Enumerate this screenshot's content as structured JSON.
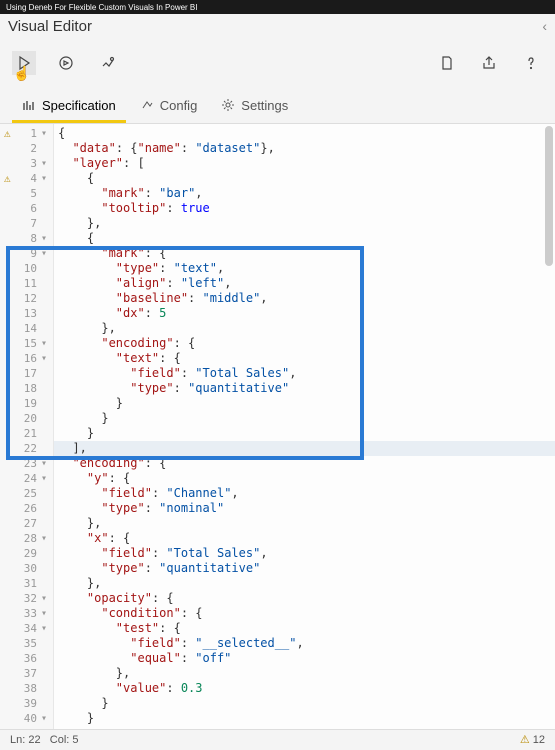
{
  "video_title": "Using Deneb For Flexible Custom Visuals In Power BI",
  "panel_title": "Visual Editor",
  "tabs": [
    {
      "label": "Specification",
      "active": true
    },
    {
      "label": "Config",
      "active": false
    },
    {
      "label": "Settings",
      "active": false
    }
  ],
  "status": {
    "ln": "Ln: 22",
    "col": "Col: 5",
    "warnings": "12"
  },
  "gutter": [
    {
      "n": "1",
      "warn": true,
      "fold": "▾"
    },
    {
      "n": "2"
    },
    {
      "n": "3",
      "fold": "▾"
    },
    {
      "n": "4",
      "warn": true,
      "fold": "▾"
    },
    {
      "n": "5"
    },
    {
      "n": "6"
    },
    {
      "n": "7"
    },
    {
      "n": "8",
      "fold": "▾"
    },
    {
      "n": "9",
      "fold": "▾"
    },
    {
      "n": "10"
    },
    {
      "n": "11"
    },
    {
      "n": "12"
    },
    {
      "n": "13"
    },
    {
      "n": "14"
    },
    {
      "n": "15",
      "fold": "▾"
    },
    {
      "n": "16",
      "fold": "▾"
    },
    {
      "n": "17"
    },
    {
      "n": "18"
    },
    {
      "n": "19"
    },
    {
      "n": "20"
    },
    {
      "n": "21"
    },
    {
      "n": "22"
    },
    {
      "n": "23",
      "fold": "▾"
    },
    {
      "n": "24",
      "fold": "▾"
    },
    {
      "n": "25"
    },
    {
      "n": "26"
    },
    {
      "n": "27"
    },
    {
      "n": "28",
      "fold": "▾"
    },
    {
      "n": "29"
    },
    {
      "n": "30"
    },
    {
      "n": "31"
    },
    {
      "n": "32",
      "fold": "▾"
    },
    {
      "n": "33",
      "fold": "▾"
    },
    {
      "n": "34",
      "fold": "▾"
    },
    {
      "n": "35"
    },
    {
      "n": "36"
    },
    {
      "n": "37"
    },
    {
      "n": "38"
    },
    {
      "n": "39"
    },
    {
      "n": "40",
      "fold": "▾"
    }
  ],
  "code": [
    [
      [
        "p",
        "{"
      ]
    ],
    [
      [
        "p",
        "  "
      ],
      [
        "k",
        "\"data\""
      ],
      [
        "p",
        ": {"
      ],
      [
        "k",
        "\"name\""
      ],
      [
        "p",
        ": "
      ],
      [
        "s",
        "\"dataset\""
      ],
      [
        "p",
        "},"
      ]
    ],
    [
      [
        "p",
        "  "
      ],
      [
        "k",
        "\"layer\""
      ],
      [
        "p",
        ": ["
      ]
    ],
    [
      [
        "p",
        "    {"
      ]
    ],
    [
      [
        "p",
        "      "
      ],
      [
        "k",
        "\"mark\""
      ],
      [
        "p",
        ": "
      ],
      [
        "s",
        "\"bar\""
      ],
      [
        "p",
        ","
      ]
    ],
    [
      [
        "p",
        "      "
      ],
      [
        "k",
        "\"tooltip\""
      ],
      [
        "p",
        ": "
      ],
      [
        "b",
        "true"
      ]
    ],
    [
      [
        "p",
        "    },"
      ]
    ],
    [
      [
        "p",
        "    {"
      ]
    ],
    [
      [
        "p",
        "      "
      ],
      [
        "k",
        "\"mark\""
      ],
      [
        "p",
        ": {"
      ]
    ],
    [
      [
        "p",
        "        "
      ],
      [
        "k",
        "\"type\""
      ],
      [
        "p",
        ": "
      ],
      [
        "s",
        "\"text\""
      ],
      [
        "p",
        ","
      ]
    ],
    [
      [
        "p",
        "        "
      ],
      [
        "k",
        "\"align\""
      ],
      [
        "p",
        ": "
      ],
      [
        "s",
        "\"left\""
      ],
      [
        "p",
        ","
      ]
    ],
    [
      [
        "p",
        "        "
      ],
      [
        "k",
        "\"baseline\""
      ],
      [
        "p",
        ": "
      ],
      [
        "s",
        "\"middle\""
      ],
      [
        "p",
        ","
      ]
    ],
    [
      [
        "p",
        "        "
      ],
      [
        "k",
        "\"dx\""
      ],
      [
        "p",
        ": "
      ],
      [
        "n",
        "5"
      ]
    ],
    [
      [
        "p",
        "      },"
      ]
    ],
    [
      [
        "p",
        "      "
      ],
      [
        "k",
        "\"encoding\""
      ],
      [
        "p",
        ": {"
      ]
    ],
    [
      [
        "p",
        "        "
      ],
      [
        "k",
        "\"text\""
      ],
      [
        "p",
        ": {"
      ]
    ],
    [
      [
        "p",
        "          "
      ],
      [
        "k",
        "\"field\""
      ],
      [
        "p",
        ": "
      ],
      [
        "s",
        "\"Total Sales\""
      ],
      [
        "p",
        ","
      ]
    ],
    [
      [
        "p",
        "          "
      ],
      [
        "k",
        "\"type\""
      ],
      [
        "p",
        ": "
      ],
      [
        "s",
        "\"quantitative\""
      ]
    ],
    [
      [
        "p",
        "        }"
      ]
    ],
    [
      [
        "p",
        "      }"
      ]
    ],
    [
      [
        "p",
        "    }"
      ]
    ],
    [
      [
        "p",
        "  ],"
      ]
    ],
    [
      [
        "p",
        "  "
      ],
      [
        "k",
        "\"encoding\""
      ],
      [
        "p",
        ": {"
      ]
    ],
    [
      [
        "p",
        "    "
      ],
      [
        "k",
        "\"y\""
      ],
      [
        "p",
        ": {"
      ]
    ],
    [
      [
        "p",
        "      "
      ],
      [
        "k",
        "\"field\""
      ],
      [
        "p",
        ": "
      ],
      [
        "s",
        "\"Channel\""
      ],
      [
        "p",
        ","
      ]
    ],
    [
      [
        "p",
        "      "
      ],
      [
        "k",
        "\"type\""
      ],
      [
        "p",
        ": "
      ],
      [
        "s",
        "\"nominal\""
      ]
    ],
    [
      [
        "p",
        "    },"
      ]
    ],
    [
      [
        "p",
        "    "
      ],
      [
        "k",
        "\"x\""
      ],
      [
        "p",
        ": {"
      ]
    ],
    [
      [
        "p",
        "      "
      ],
      [
        "k",
        "\"field\""
      ],
      [
        "p",
        ": "
      ],
      [
        "s",
        "\"Total Sales\""
      ],
      [
        "p",
        ","
      ]
    ],
    [
      [
        "p",
        "      "
      ],
      [
        "k",
        "\"type\""
      ],
      [
        "p",
        ": "
      ],
      [
        "s",
        "\"quantitative\""
      ]
    ],
    [
      [
        "p",
        "    },"
      ]
    ],
    [
      [
        "p",
        "    "
      ],
      [
        "k",
        "\"opacity\""
      ],
      [
        "p",
        ": {"
      ]
    ],
    [
      [
        "p",
        "      "
      ],
      [
        "k",
        "\"condition\""
      ],
      [
        "p",
        ": {"
      ]
    ],
    [
      [
        "p",
        "        "
      ],
      [
        "k",
        "\"test\""
      ],
      [
        "p",
        ": {"
      ]
    ],
    [
      [
        "p",
        "          "
      ],
      [
        "k",
        "\"field\""
      ],
      [
        "p",
        ": "
      ],
      [
        "s",
        "\"__selected__\""
      ],
      [
        "p",
        ","
      ]
    ],
    [
      [
        "p",
        "          "
      ],
      [
        "k",
        "\"equal\""
      ],
      [
        "p",
        ": "
      ],
      [
        "s",
        "\"off\""
      ]
    ],
    [
      [
        "p",
        "        },"
      ]
    ],
    [
      [
        "p",
        "        "
      ],
      [
        "k",
        "\"value\""
      ],
      [
        "p",
        ": "
      ],
      [
        "n",
        "0.3"
      ]
    ],
    [
      [
        "p",
        "      }"
      ]
    ],
    [
      [
        "p",
        "    }"
      ]
    ]
  ],
  "active_line": 22
}
